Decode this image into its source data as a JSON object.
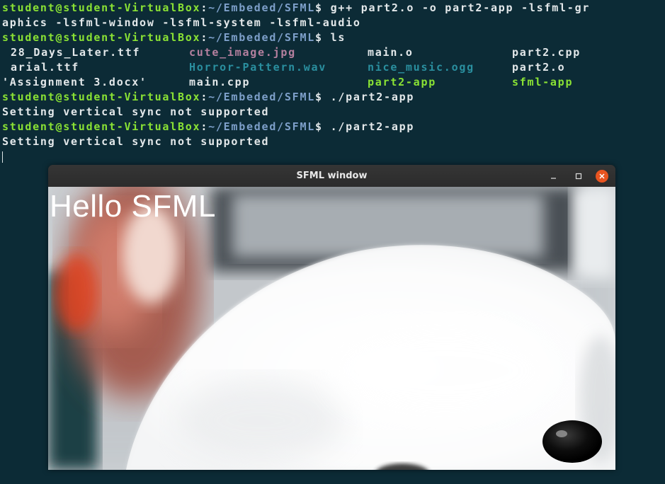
{
  "terminal": {
    "prompt_user": "student@student-VirtualBox",
    "prompt_sep": ":",
    "prompt_path": "~/Embeded/SFML",
    "prompt_symbol": "$",
    "cmd1_part1": " g++ part2.o -o part2-app -lsfml-gr",
    "cmd1_part2": "aphics -lsfml-window -lsfml-system -lsfml-audio",
    "cmd2": " ls",
    "ls": {
      "row1": [
        "28_Days_Later.ttf",
        "cute_image.jpg",
        "main.o",
        "part2.cpp"
      ],
      "row2": [
        "arial.ttf",
        "Horror-Pattern.wav",
        "nice_music.ogg",
        "part2.o"
      ],
      "row3": [
        "'Assignment 3.docx'",
        "main.cpp",
        "part2-app",
        "sfml-app"
      ]
    },
    "cmd3": " ./part2-app",
    "output1": "Setting vertical sync not supported",
    "cmd4": " ./part2-app",
    "output2": "Setting vertical sync not supported"
  },
  "window": {
    "title": "SFML window",
    "minimize_icon": "–",
    "maximize_icon": "□",
    "close_icon": "✕"
  },
  "canvas": {
    "text": "Hello SFML",
    "image": "fluffy white puppy close-up"
  },
  "colors": {
    "terminal_bg": "#0c2b36",
    "prompt_user": "#8ae234",
    "prompt_path": "#7d9fc9",
    "close_button": "#e95420"
  }
}
